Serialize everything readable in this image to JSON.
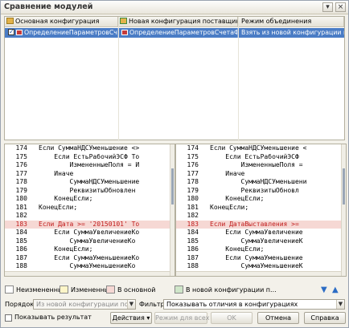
{
  "window": {
    "title": "Сравнение модулей"
  },
  "grid": {
    "headers": [
      "Основная конфигурация",
      "Новая конфигурация поставщика",
      "Режим объединения"
    ],
    "rows": [
      {
        "main": "ОпределениеПараметровСчетаФакт...",
        "new": "ОпределениеПараметровСчетаФак...",
        "mode": "Взять из новой конфигурации поста..."
      }
    ]
  },
  "left_pane": {
    "lines": [
      {
        "num": "174",
        "text": "Если СуммаНДСУменьшение <>"
      },
      {
        "num": "175",
        "text": "    Если ЕстьРабочийЭСФ То"
      },
      {
        "num": "176",
        "text": "        ИзмененныеПоля = И"
      },
      {
        "num": "177",
        "text": "    Иначе"
      },
      {
        "num": "178",
        "text": "        СуммаНДСУменьшение"
      },
      {
        "num": "179",
        "text": "        РеквизитыОбновлен"
      },
      {
        "num": "180",
        "text": "    КонецЕсли;"
      },
      {
        "num": "181",
        "text": "КонецЕсли;"
      },
      {
        "num": "182",
        "text": ""
      },
      {
        "num": "183",
        "text": "Если Дата >= '20150101' То"
      },
      {
        "num": "184",
        "text": "    Если СуммаУвеличениеКо"
      },
      {
        "num": "185",
        "text": "        СуммаУвеличениеКо"
      },
      {
        "num": "186",
        "text": "    КонецЕсли;"
      },
      {
        "num": "187",
        "text": "    Если СуммаУменьшениеКо"
      },
      {
        "num": "188",
        "text": "        СуммаУменьшениеКо"
      }
    ]
  },
  "right_pane": {
    "lines": [
      {
        "num": "174",
        "text": "Если СуммаНДСУменьшение <"
      },
      {
        "num": "175",
        "text": "    Если ЕстьРабочийЭСФ"
      },
      {
        "num": "176",
        "text": "        ИзмененныеПоля ="
      },
      {
        "num": "177",
        "text": "    Иначе"
      },
      {
        "num": "178",
        "text": "        СуммаНДСУменьшени"
      },
      {
        "num": "179",
        "text": "        РеквизитыОбновл"
      },
      {
        "num": "180",
        "text": "    КонецЕсли;"
      },
      {
        "num": "181",
        "text": "КонецЕсли;"
      },
      {
        "num": "182",
        "text": ""
      },
      {
        "num": "183",
        "text": "Если ДатаВыставления >="
      },
      {
        "num": "184",
        "text": "    Если СуммаУвеличение"
      },
      {
        "num": "185",
        "text": "        СуммаУвеличениеК"
      },
      {
        "num": "186",
        "text": "    КонецЕсли;"
      },
      {
        "num": "187",
        "text": "    Если СуммаУменьшение"
      },
      {
        "num": "188",
        "text": "        СуммаУменьшениеК"
      }
    ]
  },
  "legend": {
    "unchanged": "Неизмененные",
    "changed": "Измененные",
    "in_main": "В основной",
    "in_new": "В новой конфигурации п...",
    "colors": {
      "unchanged": "#ffffff",
      "changed": "#fdf5c8",
      "in_main": "#f6d8d4",
      "in_new": "#cfe6c9"
    }
  },
  "controls": {
    "order_label": "Порядок:",
    "order_value": "Из новой конфигурации поставщи",
    "filter_label": "Фильтр:",
    "filter_value": "Показывать отличия в конфигурациях",
    "show_result_label": "Показывать результат",
    "actions_button": "Действия",
    "mode_all_button": "Режим для всех",
    "ok_button": "OK",
    "cancel_button": "Отмена",
    "help_button": "Справка"
  }
}
